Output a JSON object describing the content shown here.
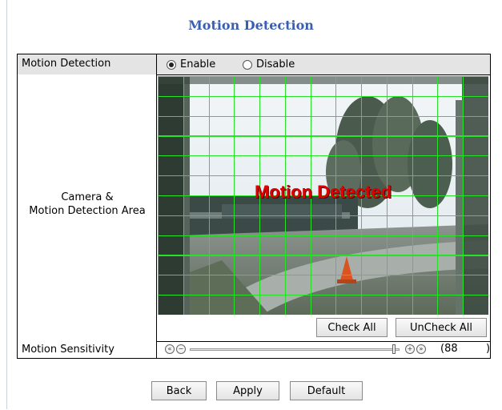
{
  "page": {
    "title": "Motion Detection"
  },
  "motion_detection": {
    "label": "Motion Detection",
    "options": [
      {
        "label": "Enable",
        "selected": true
      },
      {
        "label": "Disable",
        "selected": false
      }
    ]
  },
  "camera": {
    "label_line1": "Camera &",
    "label_line2": "Motion Detection Area",
    "overlay_text": "Motion Detected",
    "grid": {
      "columns": 13,
      "rows": 12,
      "color": "#27e327"
    },
    "check_all_label": "Check All",
    "uncheck_all_label": "UnCheck All"
  },
  "sensitivity": {
    "label": "Motion Sensitivity",
    "value_prefix": "(88",
    "value_suffix": ")",
    "level_fraction": 0.98
  },
  "buttons": {
    "back": "Back",
    "apply": "Apply",
    "default": "Default"
  },
  "colors": {
    "title": "#3a5fb2",
    "overlay_text": "#e00000",
    "row_highlight": "#e4e4e4"
  }
}
